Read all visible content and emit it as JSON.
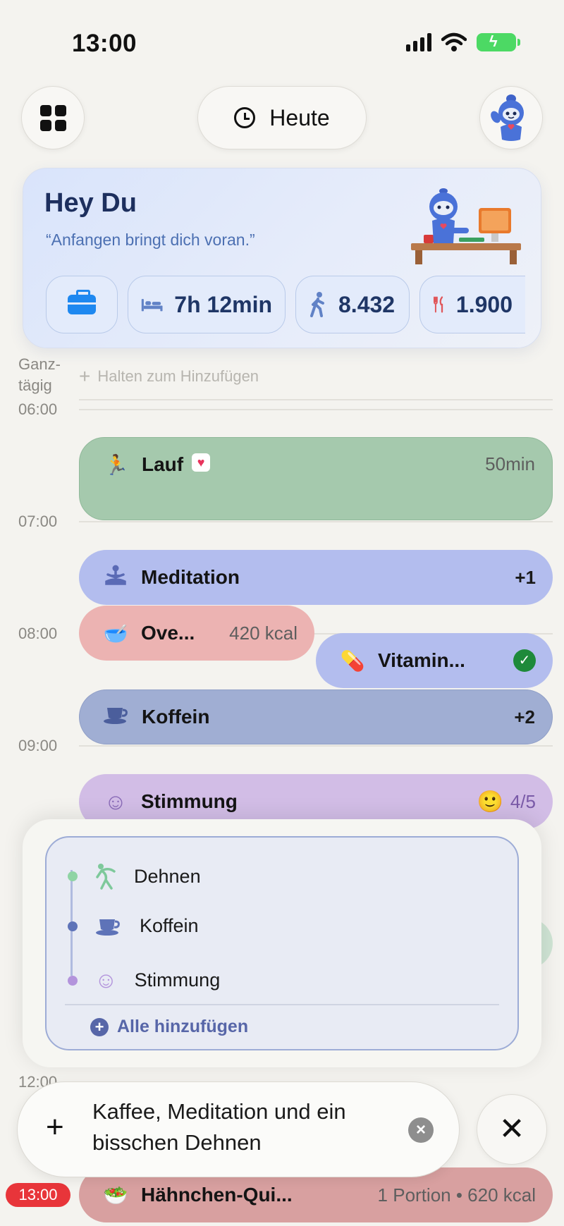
{
  "status_bar": {
    "time": "13:00"
  },
  "header": {
    "today_label": "Heute"
  },
  "hero": {
    "title": "Hey Du",
    "quote": "“Anfangen bringt dich voran.”",
    "chips": [
      {
        "icon": "briefcase-icon",
        "value": ""
      },
      {
        "icon": "bed-icon",
        "value": "7h 12min"
      },
      {
        "icon": "walk-icon",
        "value": "8.432"
      },
      {
        "icon": "fork-knife-icon",
        "value": "1.900"
      }
    ]
  },
  "timeline": {
    "all_day_label": "Ganz-\ntägig",
    "add_hint": "Halten zum Hinzufügen",
    "hours": [
      "06:00",
      "07:00",
      "08:00",
      "09:00",
      "12:00"
    ],
    "current_time": "13:00",
    "events": {
      "lauf": {
        "emoji": "🏃",
        "title": "Lauf",
        "right": "50min",
        "color": "#a5c9ad"
      },
      "meditation": {
        "title": "Meditation",
        "right": "+1",
        "color": "#b3bdee"
      },
      "oats": {
        "emoji": "🥣",
        "title": "Ove...",
        "right": "420 kcal",
        "color": "#ecb3b2"
      },
      "vitamin": {
        "emoji": "💊",
        "title": "Vitamin...",
        "color": "#b3bdee"
      },
      "koffein": {
        "title": "Koffein",
        "right": "+2",
        "color": "#a0aed3"
      },
      "stimmung": {
        "title": "Stimmung",
        "right": "4/5",
        "color": "#d2bde6"
      },
      "haehnchen": {
        "emoji": "🥗",
        "title": "Hähnchen-Qui...",
        "right": "1 Portion • 620 kcal",
        "color": "#d8a0a0"
      }
    }
  },
  "suggestions": {
    "items": [
      {
        "label": "Dehnen",
        "dot_color": "#8fd4a4"
      },
      {
        "label": "Koffein",
        "dot_color": "#5e73b8"
      },
      {
        "label": "Stimmung",
        "dot_color": "#b394dc"
      }
    ],
    "add_all_label": "Alle hinzufügen"
  },
  "composer": {
    "text": "Kaffee, Meditation und ein bisschen Dehnen"
  }
}
